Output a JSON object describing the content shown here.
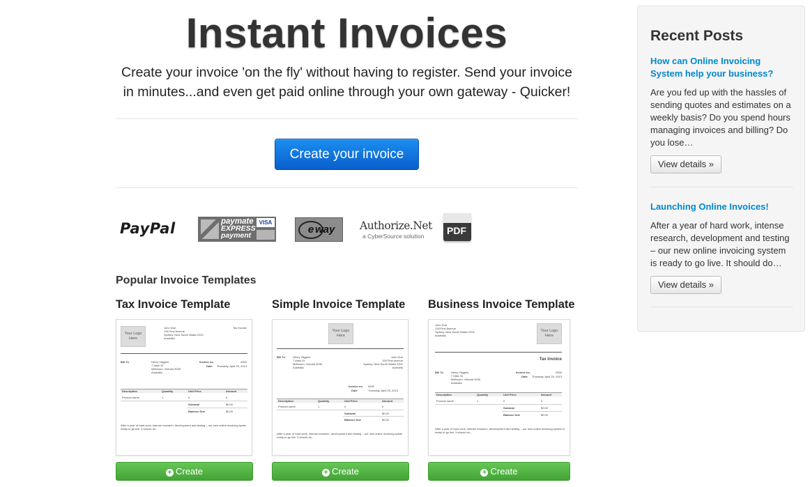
{
  "hero": {
    "title": "Instant Invoices",
    "subtitle_line1": "Create your invoice 'on the fly' without having to register. Send your invoice",
    "subtitle_line2": "in minutes...and even get paid online through your own gateway - Quicker!",
    "cta_label": "Create your invoice"
  },
  "payment_logos": {
    "paypal": "PayPal",
    "paymate_line1": "paymate",
    "paymate_line2": "EXPRESS",
    "paymate_line3": "payment",
    "paymate_badge": "VISA",
    "eway_e": "e",
    "eway_rest": "way",
    "authorize_main": "Authorize.Net",
    "authorize_sub": "a CyberSource solution",
    "pdf": "PDF"
  },
  "templates_section": {
    "title": "Popular Invoice Templates",
    "button_label": "Create",
    "button_icon": "plus-circle-icon",
    "templates": [
      {
        "title": "Tax Invoice Template"
      },
      {
        "title": "Simple Invoice Template"
      },
      {
        "title": "Business Invoice Template"
      }
    ],
    "thumb": {
      "logo_text": "Your Logo Here",
      "from_name": "John Doe",
      "from_addr1": "128 First Avenue",
      "from_addr2": "Sydney, New South Wales 2201",
      "from_country": "Australia",
      "tax_invoice_label": "Tax Invoice",
      "bill_to_label": "Bill To",
      "bill_name": "Henry Higgins",
      "bill_addr1": "7 Main St",
      "bill_addr2": "Melbourn, Victoria 3030",
      "bill_country": "Australia",
      "invoice_no_label": "Invoice no.",
      "invoice_no": "0000",
      "date_label": "Date",
      "date_value": "Thursday, April 25, 2013",
      "col_description": "Description",
      "col_quantity": "Quantity",
      "col_unit_price": "Unit Price",
      "col_amount": "Amount",
      "row_product": "Product name",
      "row_qty": "1",
      "row_price": "0",
      "row_amount": "0",
      "subtotal_label": "Subtotal",
      "subtotal_value": "$0.00",
      "balance_label": "Balance Due",
      "balance_value": "$0.00",
      "note_line1": "After a year of hard work, intense research, development and testing – our new online invoicing system is",
      "note_line2": "ready to go live. It should do..."
    }
  },
  "sidebar": {
    "title": "Recent Posts",
    "view_label": "View details »",
    "posts": [
      {
        "title": "How can Online Invoicing System help your business?",
        "excerpt": "Are you fed up with the hassles of sending quotes and estimates on a weekly basis? Do you spend hours managing invoices and billing? Do you lose…"
      },
      {
        "title": "Launching Online Invoices!",
        "excerpt": "After a year of hard work, intense research, development and testing – our new online invoicing system is ready to go live. It should do…"
      }
    ]
  }
}
